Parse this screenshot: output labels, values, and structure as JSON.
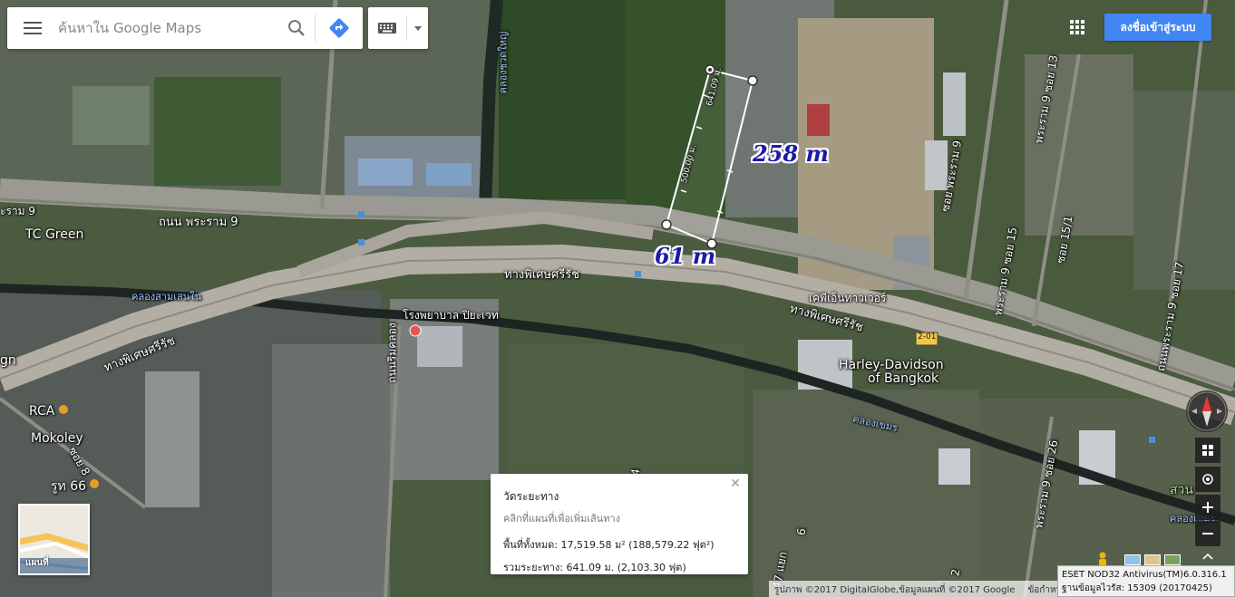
{
  "search": {
    "placeholder": "ค้นหาใน Google Maps"
  },
  "header": {
    "signin_label": "ลงชื่อเข้าสู่ระบบ"
  },
  "measurements": {
    "side_long": "258 m",
    "side_short": "61 m",
    "edge_label_1": "641.09 ม.",
    "edge_label_2": "500.00 ม."
  },
  "map_labels": {
    "rama9_road": "ถนน พระราม 9",
    "rama9_short": "ะราม 9",
    "tc_green": "TC Green",
    "expressway_1": "ทางพิเศษศรีรัช",
    "expressway_2": "ทางพิเศษศรีรัช",
    "expressway_3": "ทางพิเศษศรีรัช",
    "hospital": "โรงพยาบาล ปิยะเวท",
    "khlong_sam_sen": "คลองสามเสนใน",
    "khlong_khemra": "คลองเขมร",
    "khlong_khemra_2": "คลองเขมร",
    "khlong_left": "คลองชวดใหญ่",
    "kpn_tower": "เคพีเอ็นทาวเวอร์",
    "harley_1": "Harley-Davidson",
    "harley_2": "of Bangkok",
    "soi13": "พระราม 9 ซอย 13",
    "soi15": "พระราม 9 ซอย 15",
    "soi15_1": "ซอย 15/1",
    "soi17": "ถนนพระราม 9 ซอย 17",
    "soi26": "พระราม 9 ซอย 26",
    "rama9_soi": "ซอย พระราม 9",
    "rca": "RCA",
    "mokoley": "Mokoley",
    "route66": "รูท 66",
    "rca_soi": "ซอย 8",
    "rim_khlong": "ถนนริมคลอง",
    "route_badge": "2-01",
    "soi_34": "3-4",
    "soi_6": "6",
    "soi_47": "47 แยก",
    "soi_2": "2",
    "gn": "gn",
    "suan": "สวน"
  },
  "measure_panel": {
    "title": "วัดระยะทาง",
    "hint": "คลิกที่แผนที่เพื่อเพิ่มเส้นทาง",
    "area": "พื้นที่ทั้งหมด: 17,519.58 ม² (188,579.22 ฟุต²)",
    "distance": "รวมระยะทาง: 641.09 ม. (2,103.30 ฟุต)"
  },
  "minimap": {
    "label": "แผนที่"
  },
  "attribution": {
    "imagery": "รูปภาพ ©2017 DigitalGlobe,ข้อมูลแผนที่ ©2017 Google",
    "terms": "ข้อกำหนด"
  },
  "eset": {
    "line1": "ESET NOD32 Antivirus(TM)6.0.316.1",
    "line2": "ฐานข้อมูลไวรัส: 15309 (20170425)"
  },
  "colors": {
    "accent": "#4285f4",
    "measure_text": "#1a1aa8"
  }
}
